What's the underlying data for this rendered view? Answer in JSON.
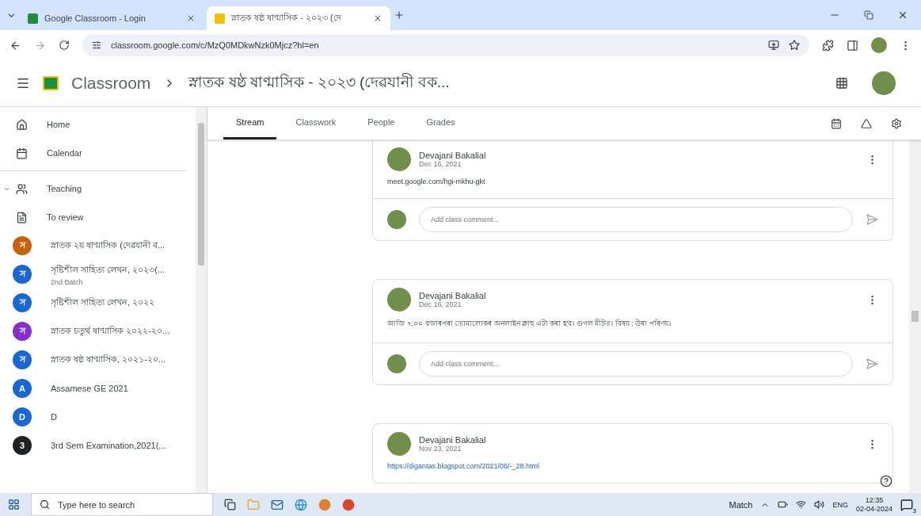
{
  "browser": {
    "tabs": [
      {
        "title": "Google Classroom - Login",
        "selected": false
      },
      {
        "title": "স্নাতক ষষ্ঠ ষাণ্মাসিক - ২০২৩ (দে",
        "selected": true
      }
    ],
    "url": "classroom.google.com/c/MzQ0MDkwNzk0Mjcz?hl=en"
  },
  "header": {
    "app_name": "Classroom",
    "course_title": "স্নাতক ষষ্ঠ ষাণ্মাসিক - ২০২৩ (দেৱযানী বক..."
  },
  "sidebar": {
    "nav": [
      {
        "kind": "home",
        "label": "Home"
      },
      {
        "kind": "calendar",
        "label": "Calendar"
      },
      {
        "kind": "teaching",
        "label": "Teaching",
        "expanded": true
      },
      {
        "kind": "review",
        "label": "To review"
      }
    ],
    "classes": [
      {
        "initial": "স",
        "name": "স্নাতক ২য় ষাণ্মাসিক (দেৱযানী ব...",
        "color": "#c5620c"
      },
      {
        "initial": "স",
        "name": "সৃষ্টিশীল সাহিত্য লেখন, ২০২৩(...",
        "subtitle": "2nd Batch",
        "color": "#1967d2"
      },
      {
        "initial": "স",
        "name": "সৃষ্টিশীল সাহিত্য লেখন, ২০২২",
        "color": "#1967d2"
      },
      {
        "initial": "স",
        "name": "স্নাতক চতুৰ্থ ষাণ্মাসিক ২০২২-২০...",
        "color": "#8430ce"
      },
      {
        "initial": "স",
        "name": "স্নাতক ষষ্ঠ ষাণ্মাসিক, ২০২১-২০...",
        "color": "#1967d2"
      },
      {
        "initial": "A",
        "name": "Assamese GE 2021",
        "color": "#1967d2"
      },
      {
        "initial": "D",
        "name": "D",
        "color": "#1967d2"
      },
      {
        "initial": "3",
        "name": "3rd Sem Examination,2021(...",
        "color": "#202124"
      }
    ]
  },
  "page_tabs": [
    {
      "label": "Stream",
      "selected": true
    },
    {
      "label": "Classwork",
      "selected": false
    },
    {
      "label": "People",
      "selected": false
    },
    {
      "label": "Grades",
      "selected": false
    }
  ],
  "posts": [
    {
      "author": "Devajani Bakalial",
      "date": "Dec 16, 2021",
      "body": "meet.google.com/hgi-mkhu-gkt",
      "kind": "text",
      "comment_placeholder": "Add class comment..."
    },
    {
      "author": "Devajani Bakalial",
      "date": "Dec 16, 2021",
      "body": "আজি ৭:০০ বজাৰপৰা তোমালোকৰ অনলাইন ক্লাছ এটা কৰা হ'ব। গুগল মীটত। বিষয় : উষা পৰিণয়।",
      "kind": "text",
      "comment_placeholder": "Add class comment..."
    },
    {
      "author": "Devajani Bakalial",
      "date": "Nov 23, 2021",
      "body": "https://digantas.blogspot.com/2021/06/-_28.html",
      "kind": "link"
    }
  ],
  "taskbar": {
    "search_placeholder": "Type here to search",
    "widget": "Match",
    "language": "ENG",
    "time": "12:35",
    "date": "02-04-2024",
    "notifications": "3"
  }
}
